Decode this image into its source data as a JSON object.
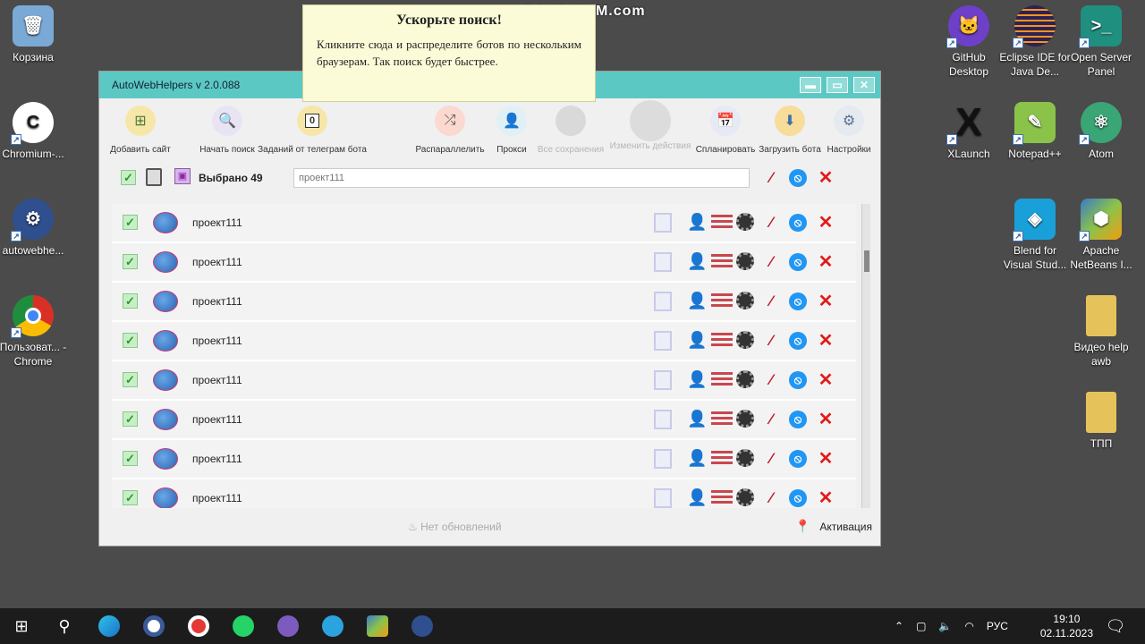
{
  "watermark": "www.BANDICAM.com",
  "desktop": {
    "left_icons": [
      {
        "label": "Корзина",
        "color": "#7aa9d6"
      },
      {
        "label": "Chromium-...",
        "color": "#1a1a1a"
      },
      {
        "label": "autowebhe...",
        "color": "#2f4f8f"
      },
      {
        "label": "Пользоват... - Chrome",
        "color": "#d93025"
      }
    ],
    "right_icons": [
      {
        "label": "GitHub Desktop",
        "color": "#6e40c9"
      },
      {
        "label": "Eclipse IDE for Java De...",
        "color": "#2c2255"
      },
      {
        "label": "Open Server Panel",
        "color": "#1f8f7f"
      },
      {
        "label": "XLaunch",
        "color": "#111111"
      },
      {
        "label": "Notepad++",
        "color": "#8bc34a"
      },
      {
        "label": "Atom",
        "color": "#3aa675"
      },
      {
        "label": "Blend for Visual Stud...",
        "color": "#1aa0d8"
      },
      {
        "label": "Apache NetBeans I...",
        "color": "#3b7ac9"
      },
      {
        "label": "Видео help awb",
        "color": "#e6c25a"
      },
      {
        "label": "ТПП",
        "color": "#e6c25a"
      }
    ]
  },
  "window": {
    "title": "AutoWebHelpers v 2.0.088",
    "controls": {
      "minimize": "▬",
      "maximize": "▭",
      "close": "✕"
    }
  },
  "toolbar": {
    "add_site": "Добавить сайт",
    "start_search": "Начать поиск",
    "telegram_tasks": "Заданий от телеграм бота",
    "telegram_count": "0",
    "parallelize": "Распараллелить",
    "proxies": "Прокси",
    "all_saves": "Все сохранения",
    "edit_actions": "Изменить действия",
    "schedule": "Спланировать",
    "load_bot": "Загрузить бота",
    "settings": "Настройки"
  },
  "selection": {
    "selected_text": "Выбрано 49",
    "filter_placeholder": "проект111"
  },
  "tooltip": {
    "title": "Ускорьте поиск!",
    "body": "Кликните сюда и распределите ботов по нескольким браузерам. Так поиск будет быстрее."
  },
  "projects": [
    {
      "name": "проект111"
    },
    {
      "name": "проект111"
    },
    {
      "name": "проект111"
    },
    {
      "name": "проект111"
    },
    {
      "name": "проект111"
    },
    {
      "name": "проект111"
    },
    {
      "name": "проект111"
    },
    {
      "name": "проект111"
    }
  ],
  "footer": {
    "updates": "Нет обновлений",
    "activation": "Активация"
  },
  "taskbar": {
    "lang": "РУС",
    "time": "19:10",
    "date": "02.11.2023"
  }
}
